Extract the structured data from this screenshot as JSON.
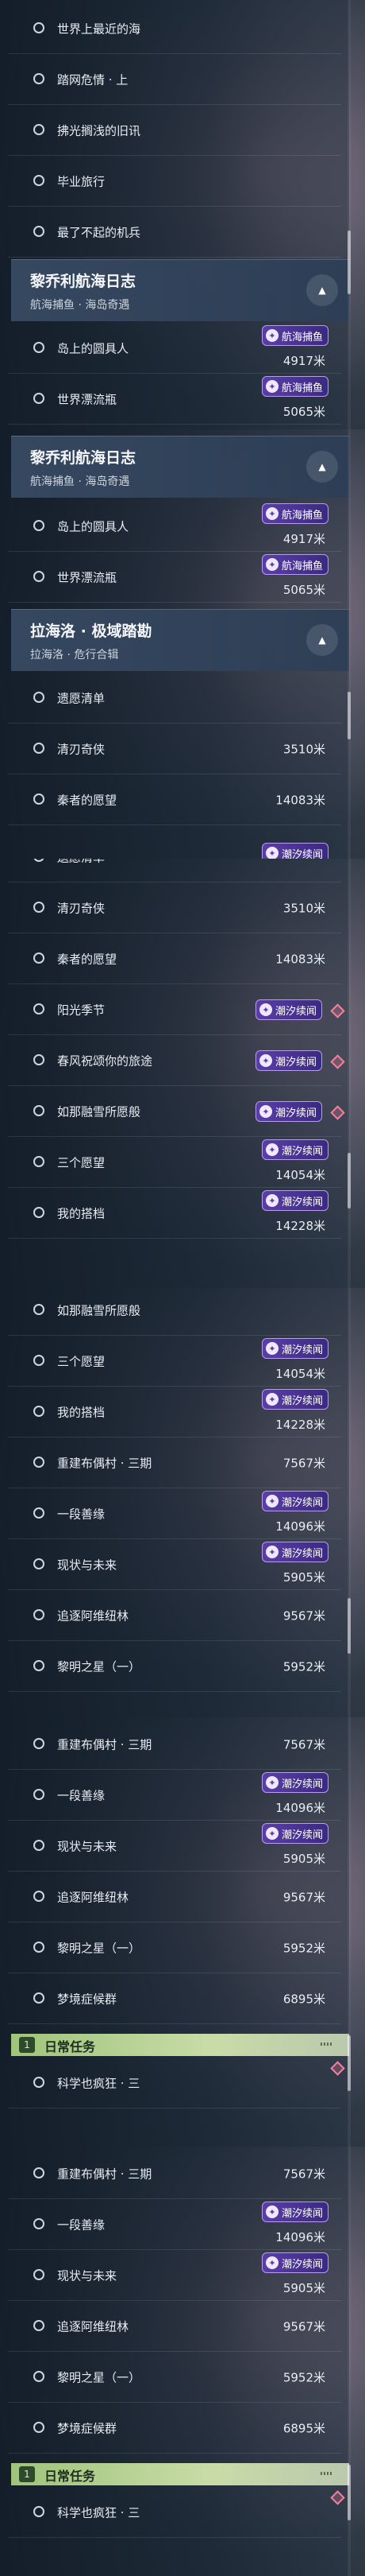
{
  "badge_label": "潮汐续闻",
  "screens": [
    {
      "rows": [
        {
          "label": "世界上最近的海"
        },
        {
          "label": "踏网危情 · 上"
        },
        {
          "label": "拂光搁浅的旧讯"
        },
        {
          "label": "毕业旅行"
        },
        {
          "label": "最了不起的机兵"
        }
      ],
      "group": {
        "title": "黎乔利航海日志",
        "subtitle": "航海捕鱼 · 海岛奇遇"
      },
      "rows2": [
        {
          "label": "岛上的圆具人",
          "distance": "4917米",
          "badge_label": "航海捕鱼"
        },
        {
          "label": "世界漂流瓶",
          "distance": "5065米",
          "badge_label": "航海捕鱼"
        }
      ]
    },
    {
      "group": {
        "title": "黎乔利航海日志",
        "subtitle": "航海捕鱼 · 海岛奇遇"
      },
      "rows": [
        {
          "label": "岛上的圆具人",
          "distance": "4917米",
          "badge_label": "航海捕鱼"
        },
        {
          "label": "世界漂流瓶",
          "distance": "5065米",
          "badge_label": "航海捕鱼"
        }
      ],
      "group2": {
        "title": "拉海洛 · 极域踏勘",
        "subtitle": "拉海洛 · 危行合辑"
      },
      "rows2": [
        {
          "label": "遗愿清单"
        },
        {
          "label": "清刃奇侠",
          "distance": "3510米"
        },
        {
          "label": "秦者的愿望",
          "distance": "14083米"
        }
      ]
    },
    {
      "rows": [
        {
          "label": "遗愿清单"
        },
        {
          "label": "清刃奇侠",
          "distance": "3510米"
        },
        {
          "label": "秦者的愿望",
          "distance": "14083米"
        },
        {
          "label": "阳光季节"
        },
        {
          "label": "春风祝颂你的旅途"
        },
        {
          "label": "如那融雪所愿般"
        },
        {
          "label": "三个愿望",
          "distance": "14054米"
        },
        {
          "label": "我的搭档",
          "distance": "14228米"
        }
      ]
    },
    {
      "rows": [
        {
          "label": "如那融雪所愿般"
        },
        {
          "label": "三个愿望",
          "distance": "14054米"
        },
        {
          "label": "我的搭档",
          "distance": "14228米"
        },
        {
          "label": "重建布偶村 · 三期",
          "distance": "7567米"
        },
        {
          "label": "一段善缘",
          "distance": "14096米"
        },
        {
          "label": "现状与未来",
          "distance": "5905米"
        },
        {
          "label": "追逐阿维纽林",
          "distance": "9567米"
        },
        {
          "label": "黎明之星（一）",
          "distance": "5952米"
        }
      ]
    },
    {
      "rows": [
        {
          "label": "重建布偶村 · 三期",
          "distance": "7567米"
        },
        {
          "label": "一段善缘",
          "distance": "14096米"
        },
        {
          "label": "现状与未来",
          "distance": "5905米"
        },
        {
          "label": "追逐阿维纽林",
          "distance": "9567米"
        },
        {
          "label": "黎明之星（一）",
          "distance": "5952米"
        },
        {
          "label": "梦境症候群",
          "distance": "6895米"
        }
      ],
      "daily": {
        "title": "日常任务"
      },
      "rows2": [
        {
          "label": "科学也疯狂 · 三"
        }
      ]
    },
    {
      "rows": [
        {
          "label": "重建布偶村 · 三期",
          "distance": "7567米"
        },
        {
          "label": "一段善缘",
          "distance": "14096米"
        },
        {
          "label": "现状与未来",
          "distance": "5905米"
        },
        {
          "label": "追逐阿维纽林",
          "distance": "9567米"
        },
        {
          "label": "黎明之星（一）",
          "distance": "5952米"
        },
        {
          "label": "梦境症候群",
          "distance": "6895米"
        }
      ],
      "daily": {
        "title": "日常任务"
      },
      "rows2": [
        {
          "label": "科学也疯狂 · 三"
        }
      ]
    }
  ]
}
